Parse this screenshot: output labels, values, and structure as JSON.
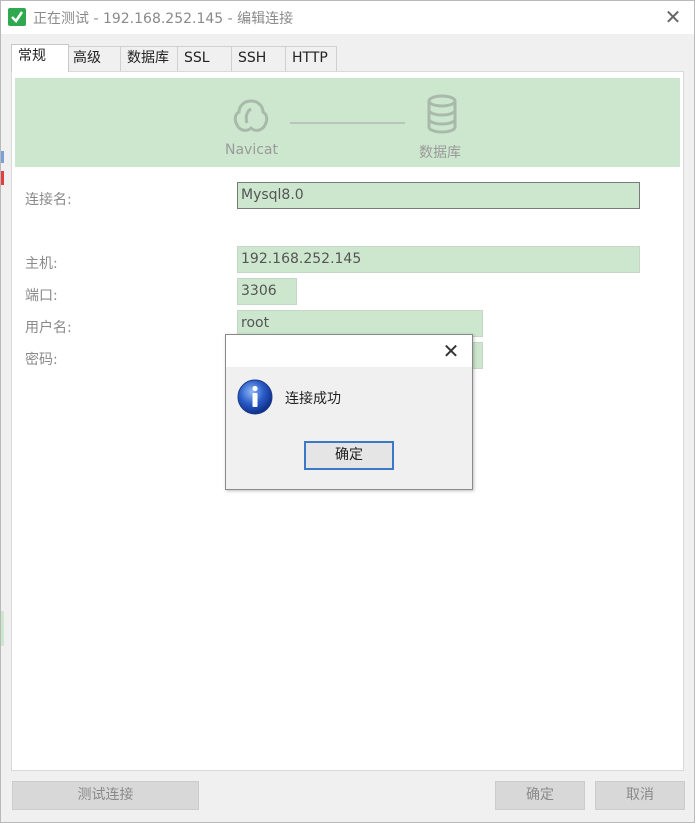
{
  "window": {
    "title": "正在测试 - 192.168.252.145 - 编辑连接",
    "close_glyph": "✕"
  },
  "tabs": [
    {
      "label": "常规",
      "active": true
    },
    {
      "label": "高级",
      "active": false
    },
    {
      "label": "数据库",
      "active": false
    },
    {
      "label": "SSL",
      "active": false
    },
    {
      "label": "SSH",
      "active": false
    },
    {
      "label": "HTTP",
      "active": false
    }
  ],
  "banner": {
    "left_label": "Navicat",
    "right_label": "数据库",
    "left_icon": "navicat-logo-icon",
    "right_icon": "database-icon"
  },
  "form": {
    "connection_name_label": "连接名:",
    "connection_name_value": "Mysql8.0",
    "host_label": "主机:",
    "host_value": "192.168.252.145",
    "port_label": "端口:",
    "port_value": "3306",
    "username_label": "用户名:",
    "username_value": "root",
    "password_label": "密码:",
    "password_value": ""
  },
  "buttons": {
    "test_connection": "测试连接",
    "ok": "确定",
    "cancel": "取消"
  },
  "dialog": {
    "message": "连接成功",
    "ok": "确定",
    "close_glyph": "✕",
    "icon": "info-icon"
  },
  "colors": {
    "field_bg": "#cde7cf",
    "focus_blue": "#3c78c8"
  }
}
